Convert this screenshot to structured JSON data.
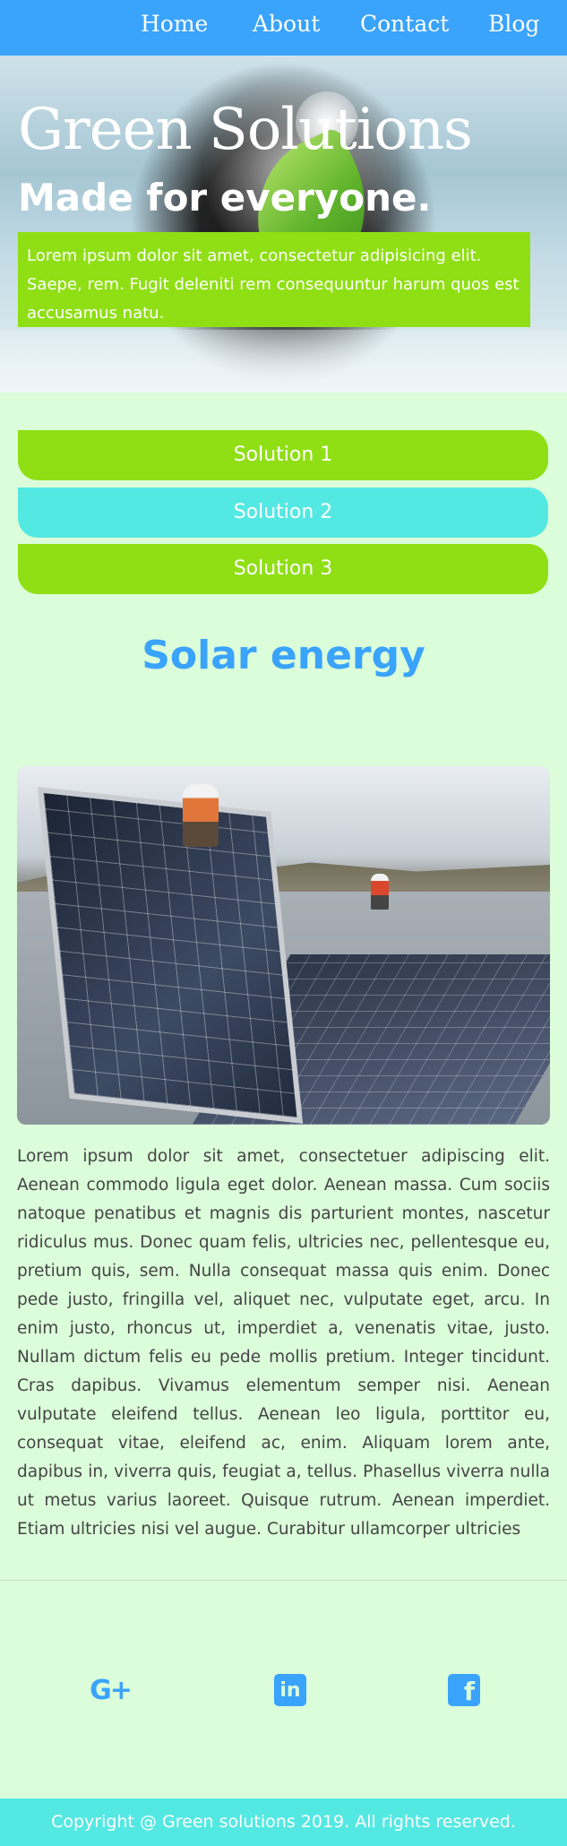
{
  "nav": {
    "items": [
      {
        "label": "Home"
      },
      {
        "label": "About"
      },
      {
        "label": "Contact"
      },
      {
        "label": "Blog"
      }
    ]
  },
  "hero": {
    "title": "Green Solutions",
    "subtitle": "Made for everyone.",
    "text": "Lorem ipsum dolor sit amet, consectetur adipisicing elit. Saepe, rem. Fugit deleniti rem consequuntur harum quos est accusamus natu."
  },
  "solutions": [
    {
      "label": "Solution 1",
      "color": "#8fdf14"
    },
    {
      "label": "Solution 2",
      "color": "#54e8e3"
    },
    {
      "label": "Solution 3",
      "color": "#8fdf14"
    }
  ],
  "section": {
    "title": "Solar energy",
    "body": "Lorem ipsum dolor sit amet, consectetuer adipiscing elit. Aenean commodo ligula eget dolor. Aenean massa. Cum sociis natoque penatibus et magnis dis parturient montes, nascetur ridiculus mus. Donec quam felis, ultricies nec, pellentesque eu, pretium quis, sem. Nulla consequat massa quis enim. Donec pede justo, fringilla vel, aliquet nec, vulputate eget, arcu. In enim justo, rhoncus ut, imperdiet a, venenatis vitae, justo. Nullam dictum felis eu pede mollis pretium. Integer tincidunt. Cras dapibus. Vivamus elementum semper nisi. Aenean vulputate eleifend tellus. Aenean leo ligula, porttitor eu, consequat vitae, eleifend ac, enim. Aliquam lorem ante, dapibus in, viverra quis, feugiat a, tellus. Phasellus viverra nulla ut metus varius laoreet. Quisque rutrum. Aenean imperdiet. Etiam ultricies nisi vel augue. Curabitur ullamcorper ultricies"
  },
  "social": [
    {
      "icon": "google-plus-icon",
      "glyph": "G+"
    },
    {
      "icon": "linkedin-icon",
      "glyph": "in"
    },
    {
      "icon": "facebook-icon",
      "glyph": "f"
    }
  ],
  "footer": {
    "text": "Copyright @ Green solutions 2019. All rights reserved."
  },
  "colors": {
    "accent_blue": "#3aa3fb",
    "green": "#8fdf14",
    "cyan": "#54e8e3",
    "background": "#dbfdda"
  }
}
